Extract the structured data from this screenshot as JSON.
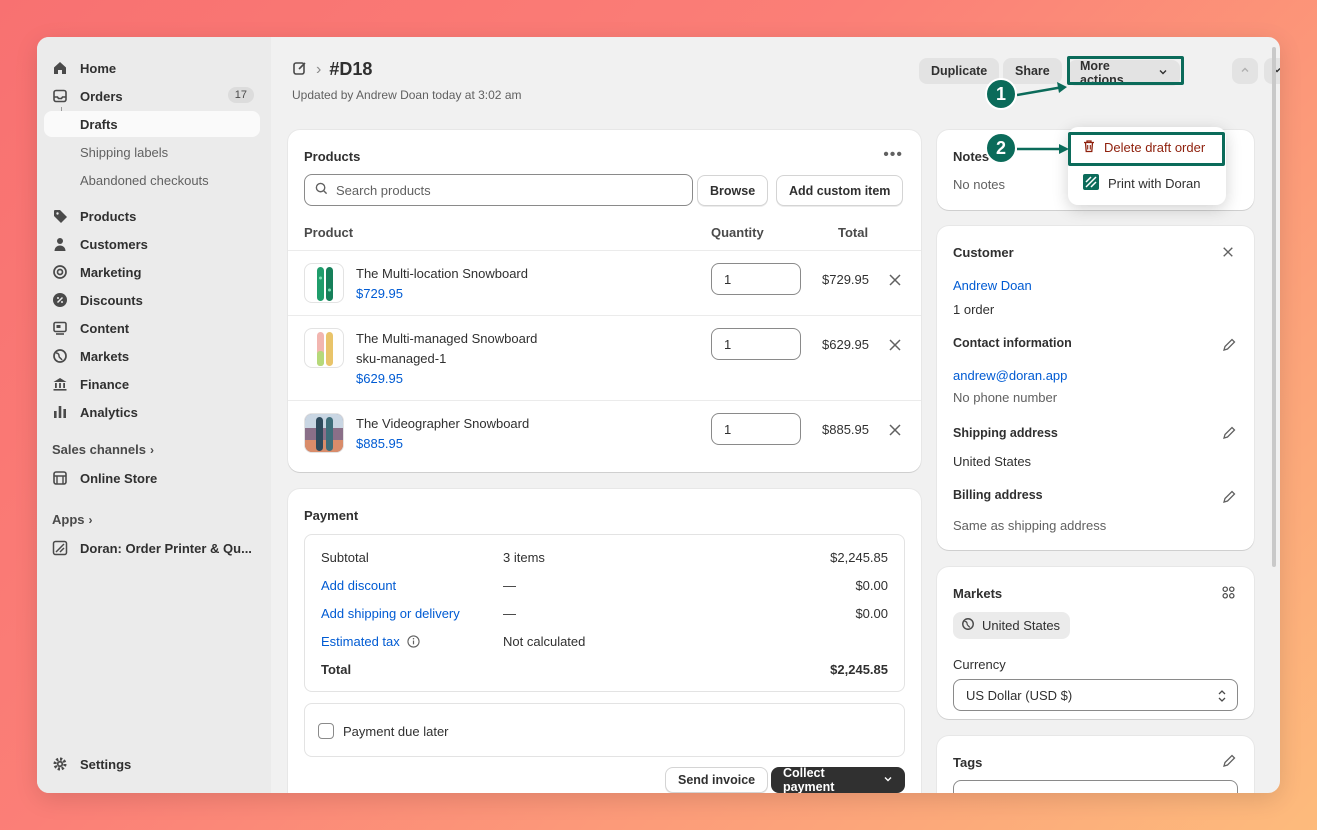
{
  "sidebar": {
    "items": [
      {
        "label": "Home",
        "icon": "home-icon"
      },
      {
        "label": "Orders",
        "icon": "inbox-icon",
        "badge": "17"
      },
      {
        "label": "Drafts"
      },
      {
        "label": "Shipping labels"
      },
      {
        "label": "Abandoned checkouts"
      },
      {
        "label": "Products",
        "icon": "tag-icon"
      },
      {
        "label": "Customers",
        "icon": "person-icon"
      },
      {
        "label": "Marketing",
        "icon": "target-icon"
      },
      {
        "label": "Discounts",
        "icon": "discount-icon"
      },
      {
        "label": "Content",
        "icon": "content-icon"
      },
      {
        "label": "Markets",
        "icon": "globe-icon"
      },
      {
        "label": "Finance",
        "icon": "bank-icon"
      },
      {
        "label": "Analytics",
        "icon": "bar-chart-icon"
      }
    ],
    "sales_channels": "Sales channels",
    "online_store": "Online Store",
    "apps": "Apps",
    "doran_app": "Doran: Order Printer & Qu...",
    "settings": "Settings"
  },
  "header": {
    "title": "#D18",
    "subtitle": "Updated by Andrew Doan today at 3:02 am",
    "duplicate": "Duplicate",
    "share": "Share",
    "more_actions": "More actions"
  },
  "dropdown": {
    "delete": "Delete draft order",
    "print": "Print with Doran"
  },
  "annotations": {
    "one": "1",
    "two": "2"
  },
  "products_card": {
    "title": "Products",
    "search_placeholder": "Search products",
    "browse": "Browse",
    "add_custom": "Add custom item",
    "col_product": "Product",
    "col_quantity": "Quantity",
    "col_total": "Total",
    "rows": [
      {
        "name": "The Multi-location Snowboard",
        "price": "$729.95",
        "qty": "1",
        "total": "$729.95"
      },
      {
        "name": "The Multi-managed Snowboard",
        "sku": "sku-managed-1",
        "price": "$629.95",
        "qty": "1",
        "total": "$629.95"
      },
      {
        "name": "The Videographer Snowboard",
        "price": "$885.95",
        "qty": "1",
        "total": "$885.95"
      }
    ]
  },
  "payment": {
    "title": "Payment",
    "subtotal_label": "Subtotal",
    "subtotal_items": "3 items",
    "subtotal_value": "$2,245.85",
    "discount_label": "Add discount",
    "discount_dash": "—",
    "discount_value": "$0.00",
    "shipping_label": "Add shipping or delivery",
    "shipping_dash": "—",
    "shipping_value": "$0.00",
    "tax_label": "Estimated tax",
    "tax_value": "Not calculated",
    "total_label": "Total",
    "total_value": "$2,245.85",
    "due_later": "Payment due later",
    "send_invoice": "Send invoice",
    "collect_payment": "Collect payment"
  },
  "notes": {
    "title": "Notes",
    "value": "No notes"
  },
  "customer": {
    "title": "Customer",
    "name": "Andrew Doan",
    "orders": "1 order",
    "contact_title": "Contact information",
    "email": "andrew@doran.app",
    "phone": "No phone number",
    "shipping_title": "Shipping address",
    "shipping_value": "United States",
    "billing_title": "Billing address",
    "billing_value": "Same as shipping address"
  },
  "markets": {
    "title": "Markets",
    "market": "United States",
    "currency_label": "Currency",
    "currency_value": "US Dollar (USD $)"
  },
  "tags": {
    "title": "Tags"
  },
  "colors": {
    "accent_link": "#005bd3",
    "annotation": "#0b6b5a",
    "danger": "#8e1f0b"
  }
}
